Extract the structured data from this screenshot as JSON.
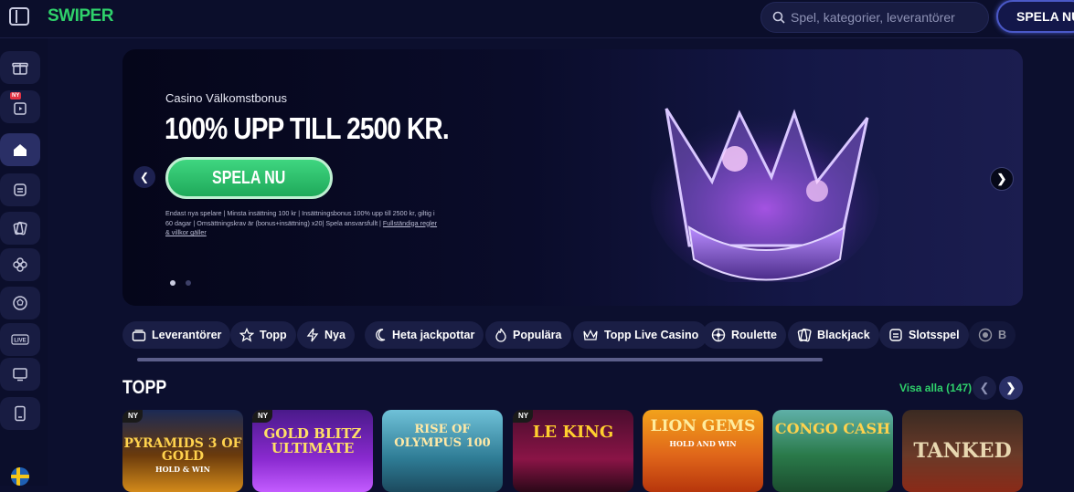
{
  "header": {
    "logo_text": "ЅWIPER",
    "search_placeholder": "Spel, kategorier, leverantörer",
    "cta_label": "SPELA NU"
  },
  "sidebar": {
    "items": [
      {
        "icon": "gift-icon"
      },
      {
        "icon": "video-icon",
        "badge": "NY"
      },
      {
        "icon": "home-icon",
        "active": true
      },
      {
        "icon": "slot-machine-icon"
      },
      {
        "icon": "cards-icon"
      },
      {
        "icon": "clover-icon"
      },
      {
        "icon": "football-icon"
      },
      {
        "icon": "live-icon"
      },
      {
        "icon": "monitor-icon"
      },
      {
        "icon": "mobile-icon"
      }
    ],
    "language_flag": "swedish-flag-icon"
  },
  "hero": {
    "subtitle": "Casino Välkomstbonus",
    "title": "100% UPP TILL 2500 KR.",
    "cta_label": "SPELA NU",
    "terms": "Endast nya spelare | Minsta insättning 100 kr | Insättningsbonus 100% upp till 2500 kr, giltig i 60 dagar | Omsättningskrav är (bonus+insättning) x20| Spela ansvarsfullt | ",
    "terms_link": "Fullständiga regler & villkor gäller",
    "slide_count": 2,
    "active_slide": 1,
    "image": "crown-icon"
  },
  "categories": [
    {
      "label": "Leverantörer",
      "icon": "providers-icon"
    },
    {
      "label": "Topp",
      "icon": "star-icon"
    },
    {
      "label": "Nya",
      "icon": "lightning-icon"
    },
    {
      "label": "Heta jackpottar",
      "icon": "moon-icon"
    },
    {
      "label": "Populära",
      "icon": "flame-icon"
    },
    {
      "label": "Topp Live Casino",
      "icon": "crown-small-icon"
    },
    {
      "label": "Roulette",
      "icon": "roulette-icon"
    },
    {
      "label": "Blackjack",
      "icon": "cards-icon"
    },
    {
      "label": "Slotsspel",
      "icon": "slot-machine-icon"
    },
    {
      "label": "B",
      "icon": "chip-icon"
    }
  ],
  "top_section": {
    "title": "TOPP",
    "see_all": "Visa alla (147)",
    "games": [
      {
        "name": "PYRAMIDS 3 OF GOLD",
        "sub": "HOLD & WIN",
        "badge": "NY",
        "color": "#7a4a10"
      },
      {
        "name": "GOLD BLITZ ULTIMATE",
        "sub": "",
        "badge": "NY",
        "color": "#5a1a8a"
      },
      {
        "name": "RISE OF OLYMPUS 100",
        "sub": "",
        "badge": "",
        "color": "#3a8a9e"
      },
      {
        "name": "LE KING",
        "sub": "",
        "badge": "NY",
        "color": "#7a1040"
      },
      {
        "name": "LION GEMS",
        "sub": "HOLD AND WIN",
        "badge": "",
        "color": "#d4680a"
      },
      {
        "name": "CONGO CASH",
        "sub": "",
        "badge": "",
        "color": "#2a7a4a"
      },
      {
        "name": "TANKED",
        "sub": "",
        "badge": "",
        "color": "#6a3a28"
      }
    ]
  }
}
